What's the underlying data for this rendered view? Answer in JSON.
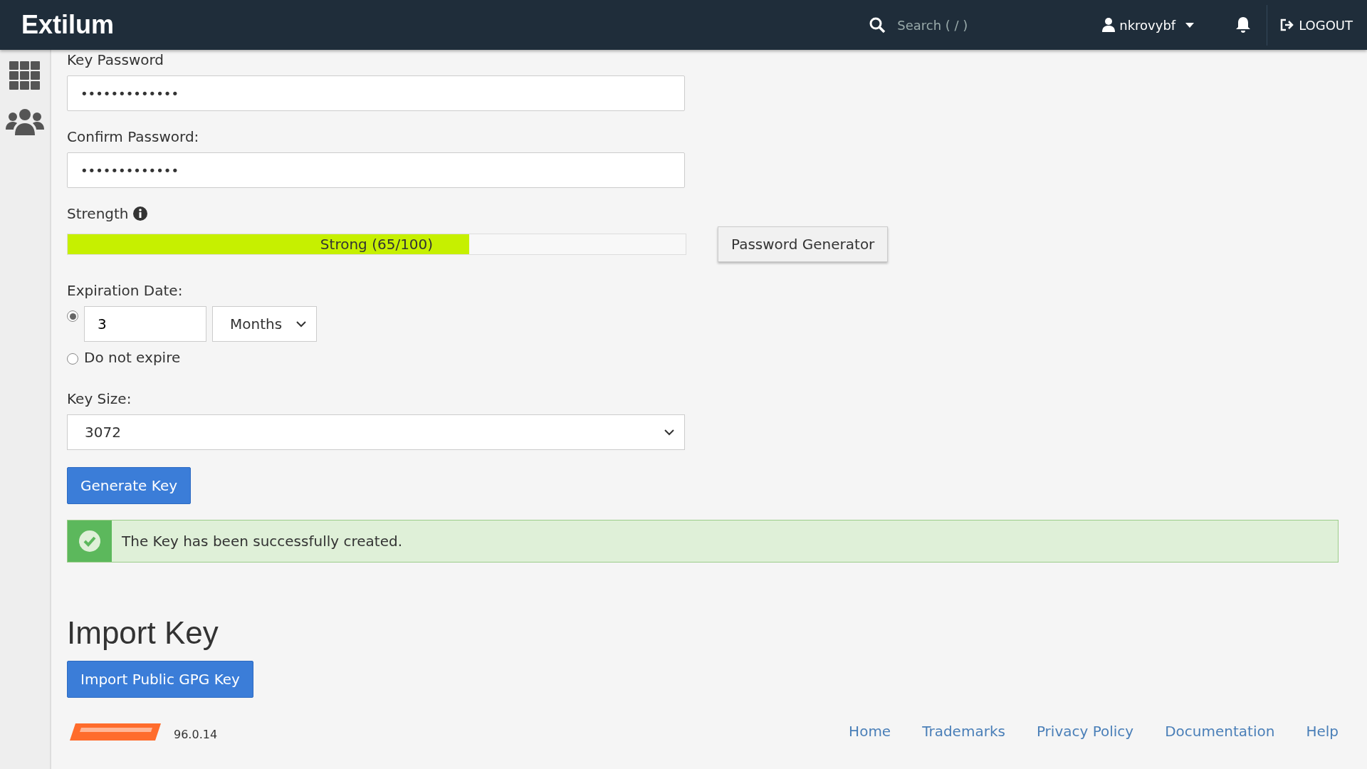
{
  "header": {
    "logo": "Extilum",
    "search": {
      "placeholder": "Search ( / )"
    },
    "user": "nkrovybf",
    "logout": "LOGOUT"
  },
  "form": {
    "key_password": {
      "label": "Key Password",
      "value": "•••••••••••••"
    },
    "confirm_password": {
      "label": "Confirm Password:",
      "value": "•••••••••••••"
    },
    "strength": {
      "label": "Strength",
      "level": 0.65,
      "reading": "Strong (65/100)"
    },
    "password_generator": "Password Generator",
    "expiration": {
      "label": "Expiration Date:",
      "options": [
        {
          "kind": "duration",
          "selected": true,
          "value": "3",
          "unit": "Months"
        },
        {
          "kind": "never",
          "selected": false,
          "label": "Do not expire"
        }
      ]
    },
    "key_size": {
      "label": "Key Size:",
      "value": "3072"
    },
    "generate_button": "Generate Key",
    "success_message": "The Key has been successfully created."
  },
  "import": {
    "title": "Import Key",
    "button": "Import Public GPG Key"
  },
  "footer": {
    "version": "96.0.14",
    "links": [
      "Home",
      "Trademarks",
      "Privacy Policy",
      "Documentation",
      "Help"
    ]
  }
}
